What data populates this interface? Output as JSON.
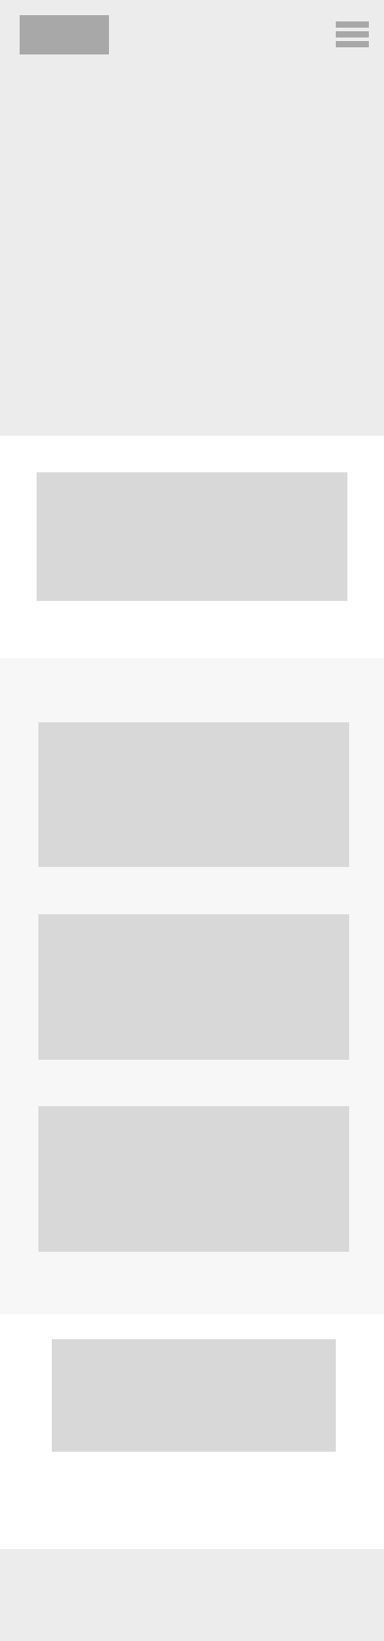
{
  "colors": {
    "hero_background": "#ececec",
    "logo_block": "#a8a8a8",
    "menu_icon": "#a8a8a8",
    "content_background": "#ffffff",
    "alt_background": "#f7f7f7",
    "placeholder_block": "#d8d8d8",
    "footer_background": "#ececec"
  },
  "header": {
    "logo_icon": "logo-placeholder",
    "menu_icon": "hamburger-menu-icon"
  }
}
